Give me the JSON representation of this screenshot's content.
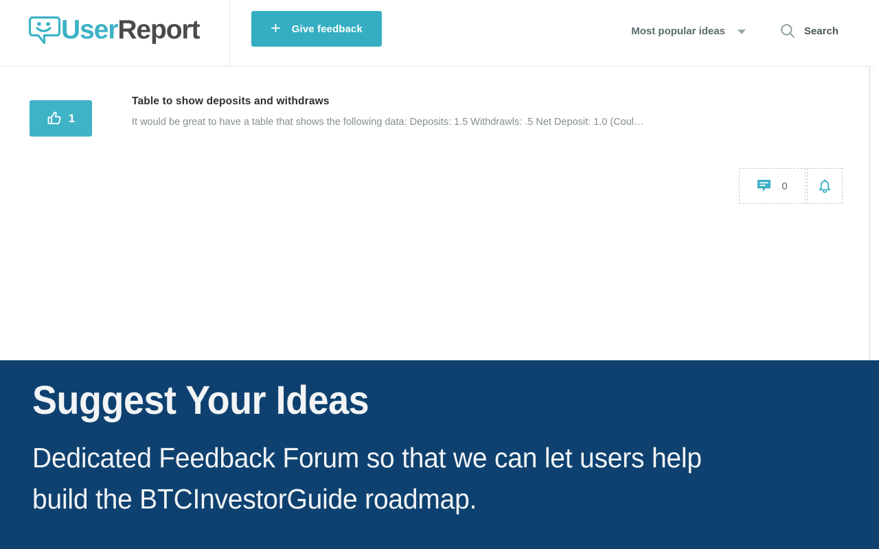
{
  "header": {
    "logo": {
      "icon": "speech-bubble-smiley-icon",
      "text_first": "User",
      "text_second": "Report",
      "brand_color": "#3db2c6",
      "text_color": "#4a4a4a"
    },
    "give_feedback": {
      "plus": "+",
      "label": "Give feedback",
      "bg_color": "#35aec3"
    },
    "sort": {
      "selected": "Most popular ideas",
      "icon": "chevron-down-icon",
      "options": [
        "Most popular ideas"
      ]
    },
    "search": {
      "label": "Search",
      "icon": "search-icon"
    }
  },
  "main": {
    "ideas": [
      {
        "votes": "1",
        "vote_icon": "thumbs-up-icon",
        "title": "Table to show deposits and withdraws",
        "description": "It would be great to have a table that shows the following data: Deposits: 1.5 Withdrawls: .5 Net Deposit: 1.0 (Coul…",
        "comments_count": "0",
        "comments_icon": "comment-bubble-icon",
        "subscribe_icon": "bell-icon",
        "accent_color": "#3fb3c6"
      }
    ]
  },
  "banner": {
    "title": "Suggest Your Ideas",
    "subtitle": "Dedicated Feedback Forum so that we can let users help build the BTCInvestorGuide roadmap.",
    "bg_color": "#0e4170",
    "text_color": "#f2f4f5"
  }
}
